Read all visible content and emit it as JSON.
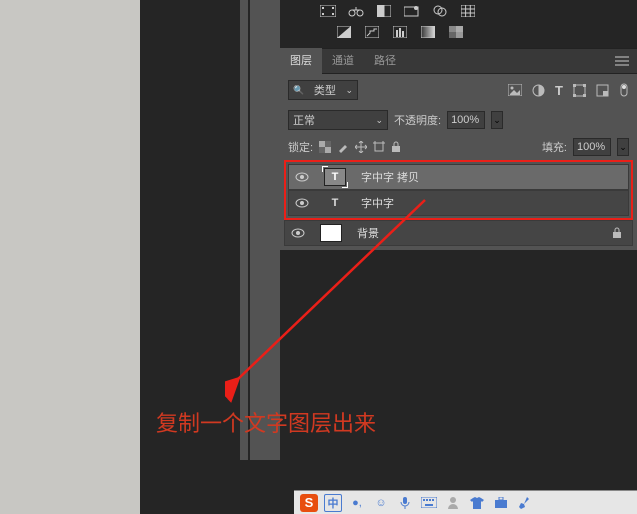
{
  "tabs": {
    "layers": "图层",
    "channels": "通道",
    "paths": "路径"
  },
  "kind": {
    "label": "类型"
  },
  "blend": {
    "mode": "正常",
    "opacity_label": "不透明度:",
    "opacity_value": "100%"
  },
  "lock": {
    "label": "锁定:",
    "fill_label": "填充:",
    "fill_value": "100%"
  },
  "layers": [
    {
      "name": "字中字 拷贝",
      "type": "text",
      "selected": true
    },
    {
      "name": "字中字",
      "type": "text",
      "selected": false
    },
    {
      "name": "背景",
      "type": "bg",
      "locked": true
    }
  ],
  "letter_t": "T",
  "search_glyph": "🔍",
  "zhong": "中",
  "annotation": "复制一个文字图层出来",
  "colors": {
    "highlight": "#ea1f18",
    "panel": "#535353"
  }
}
